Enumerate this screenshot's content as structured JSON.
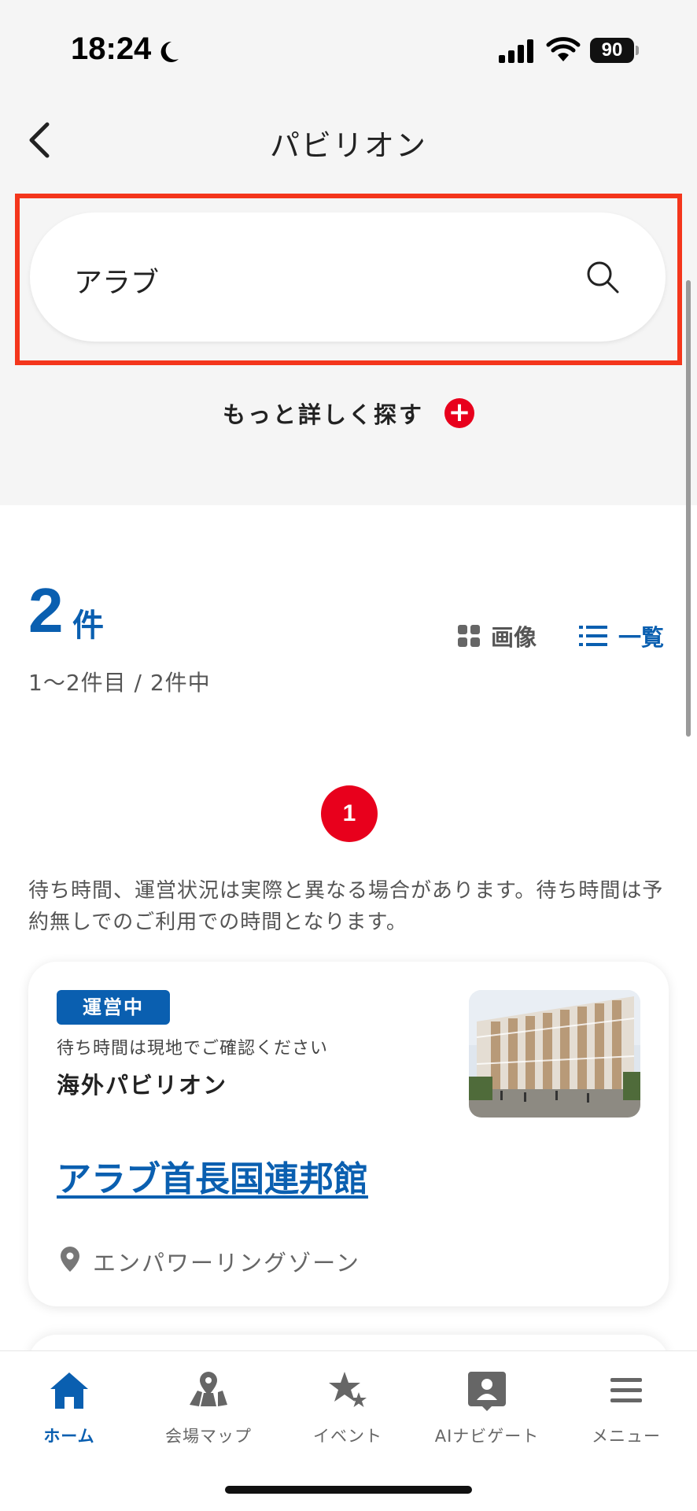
{
  "status_bar": {
    "time": "18:24",
    "battery": "90"
  },
  "header": {
    "title": "パビリオン"
  },
  "search": {
    "value": "アラブ",
    "detail_label": "もっと詳しく探す",
    "highlight_color": "#f4361c"
  },
  "results": {
    "count": "2",
    "count_unit": "件",
    "range": "1～2件目 / 2件中",
    "view_image_label": "画像",
    "view_list_label": "一覧",
    "current_page": "1",
    "notice": "待ち時間、運営状況は実際と異なる場合があります。待ち時間は予約無しでのご利用での時間となります。"
  },
  "cards": [
    {
      "status": "運営中",
      "wait": "待ち時間は現地でご確認ください",
      "category": "海外パビリオン",
      "name": "アラブ首長国連邦館",
      "zone": "エンパワーリングゾーン"
    }
  ],
  "bottom_nav": {
    "items": [
      {
        "label": "ホーム",
        "icon": "home-icon",
        "active": true
      },
      {
        "label": "会場マップ",
        "icon": "map-icon",
        "active": false
      },
      {
        "label": "イベント",
        "icon": "stars-icon",
        "active": false
      },
      {
        "label": "AIナビゲート",
        "icon": "ai-navigator-icon",
        "active": false
      },
      {
        "label": "メニュー",
        "icon": "hamburger-menu-icon",
        "active": false
      }
    ]
  },
  "colors": {
    "accent": "#0a5fb0",
    "red": "#e8001c"
  }
}
